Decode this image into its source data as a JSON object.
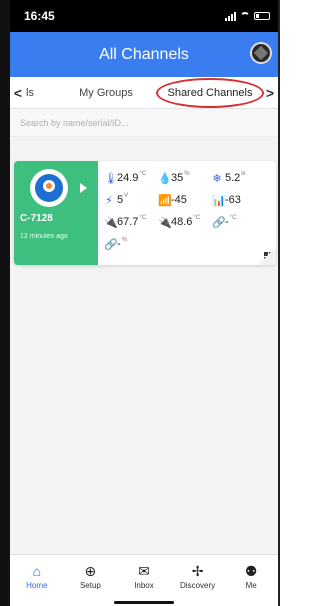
{
  "status_bar": {
    "time": "16:45"
  },
  "header": {
    "title": "All Channels"
  },
  "tabs": {
    "left_arrow": "<",
    "right_arrow": ">",
    "items": [
      {
        "label": "ls"
      },
      {
        "label": "My Groups"
      },
      {
        "label": "Shared Channels"
      }
    ]
  },
  "search": {
    "placeholder": "Search by name/serial/ID..."
  },
  "channel": {
    "name": "C-7128",
    "updated": "12 minutes ago",
    "metrics": [
      {
        "icon": "🌡",
        "value": "24.9",
        "unit": "°C"
      },
      {
        "icon": "💧",
        "value": "35",
        "unit": "%"
      },
      {
        "icon": "❄",
        "value": "5.2",
        "unit": "lx"
      },
      {
        "icon": "⚡",
        "value": "5",
        "unit": "V"
      },
      {
        "icon": "📶",
        "value": "-45",
        "unit": ""
      },
      {
        "icon": "📊",
        "value": "-63",
        "unit": ""
      },
      {
        "icon": "🔌",
        "value": "67.7",
        "unit": "°C"
      },
      {
        "icon": "🔌",
        "value": "48.6",
        "unit": "°C"
      },
      {
        "icon": "🔗",
        "value": "-",
        "unit": "°C"
      },
      {
        "icon": "🔗",
        "value": "-",
        "unit": "%"
      }
    ]
  },
  "bottom_nav": [
    {
      "label": "Home",
      "icon": "⌂",
      "active": true
    },
    {
      "label": "Setup",
      "icon": "⊕",
      "active": false
    },
    {
      "label": "Inbox",
      "icon": "✉",
      "active": false
    },
    {
      "label": "Discovery",
      "icon": "✢",
      "active": false
    },
    {
      "label": "Me",
      "icon": "⚉",
      "active": false
    }
  ],
  "colors": {
    "header": "#3a7df0",
    "card_accent": "#3fbf7f",
    "highlight_circle": "#d43030"
  }
}
